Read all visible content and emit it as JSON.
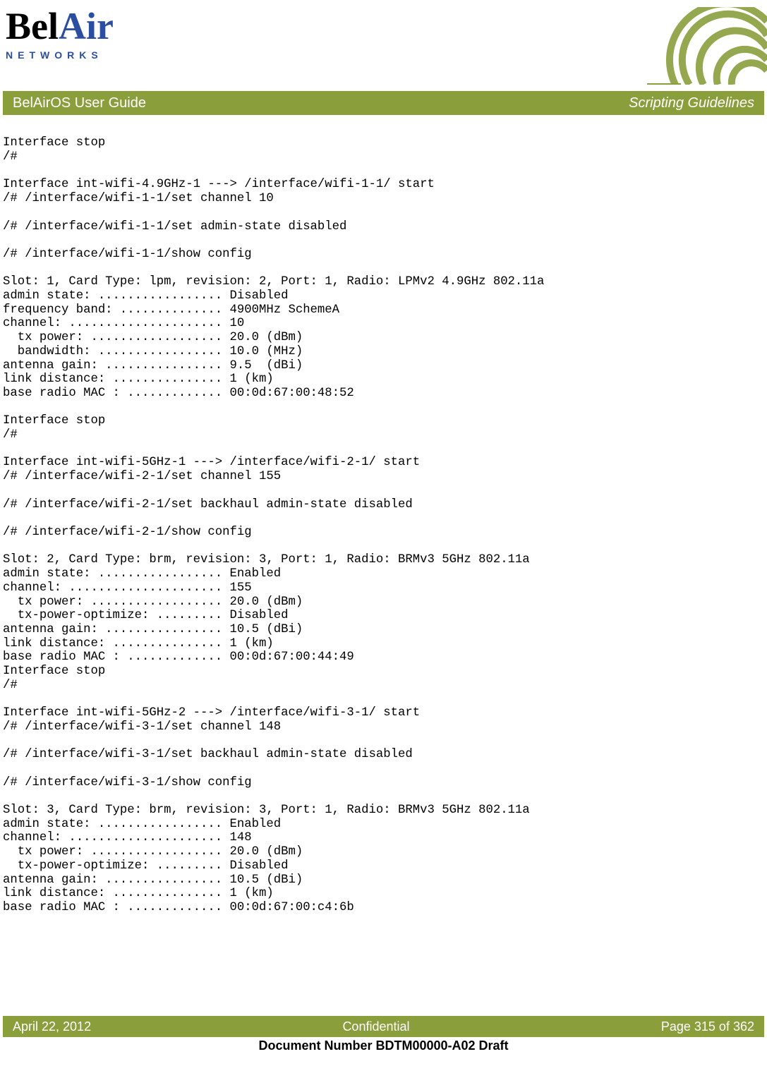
{
  "logo": {
    "part1": "Bel",
    "part2": "Air",
    "subtitle": "NETWORKS"
  },
  "bar": {
    "left": "BelAirOS User Guide",
    "right": "Scripting Guidelines"
  },
  "footer": {
    "left": "April 22, 2012",
    "center": "Confidential",
    "right": "Page 315 of 362"
  },
  "docnum": "Document Number BDTM00000-A02 Draft",
  "body": "Interface stop\n/#\n\nInterface int-wifi-4.9GHz-1 ---> /interface/wifi-1-1/ start\n/# /interface/wifi-1-1/set channel 10\n\n/# /interface/wifi-1-1/set admin-state disabled\n\n/# /interface/wifi-1-1/show config\n\nSlot: 1, Card Type: lpm, revision: 2, Port: 1, Radio: LPMv2 4.9GHz 802.11a\nadmin state: ................. Disabled\nfrequency band: .............. 4900MHz SchemeA\nchannel: ..................... 10\n  tx power: .................. 20.0 (dBm)\n  bandwidth: ................. 10.0 (MHz)\nantenna gain: ................ 9.5  (dBi)\nlink distance: ............... 1 (km)\nbase radio MAC : ............. 00:0d:67:00:48:52\n\nInterface stop\n/#\n\nInterface int-wifi-5GHz-1 ---> /interface/wifi-2-1/ start\n/# /interface/wifi-2-1/set channel 155\n\n/# /interface/wifi-2-1/set backhaul admin-state disabled\n\n/# /interface/wifi-2-1/show config\n\nSlot: 2, Card Type: brm, revision: 3, Port: 1, Radio: BRMv3 5GHz 802.11a\nadmin state: ................. Enabled\nchannel: ..................... 155\n  tx power: .................. 20.0 (dBm)\n  tx-power-optimize: ......... Disabled\nantenna gain: ................ 10.5 (dBi)\nlink distance: ............... 1 (km)\nbase radio MAC : ............. 00:0d:67:00:44:49\nInterface stop\n/#\n\nInterface int-wifi-5GHz-2 ---> /interface/wifi-3-1/ start\n/# /interface/wifi-3-1/set channel 148\n\n/# /interface/wifi-3-1/set backhaul admin-state disabled\n\n/# /interface/wifi-3-1/show config\n\nSlot: 3, Card Type: brm, revision: 3, Port: 1, Radio: BRMv3 5GHz 802.11a\nadmin state: ................. Enabled\nchannel: ..................... 148\n  tx power: .................. 20.0 (dBm)\n  tx-power-optimize: ......... Disabled\nantenna gain: ................ 10.5 (dBi)\nlink distance: ............... 1 (km)\nbase radio MAC : ............. 00:0d:67:00:c4:6b"
}
